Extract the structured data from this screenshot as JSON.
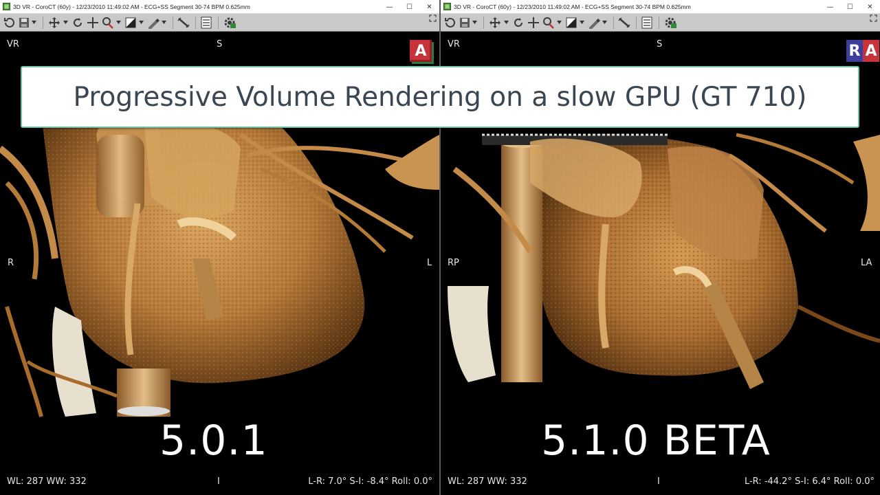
{
  "banner": {
    "text": "Progressive Volume Rendering on a slow GPU (GT 710)"
  },
  "viewers": [
    {
      "window_title": "3D VR - CoroCT (60y) - 12/23/2010 11:49:02 AM - ECG+SS Segment 30-74 BPM 0.625mm",
      "window_buttons": {
        "minimize": "—",
        "maximize": "☐",
        "close": "✕"
      },
      "labels": {
        "top_left": "VR",
        "top": "S",
        "left": "R",
        "right": "L"
      },
      "cube": [
        "A"
      ],
      "version": "5.0.1",
      "footer": {
        "window_level": "WL: 287 WW: 332",
        "center": "I",
        "rotation": "L-R: 7.0° S-I: -8.4° Roll: 0.0°"
      }
    },
    {
      "window_title": "3D VR - CoroCT (60y) - 12/23/2010 11:49:02 AM - ECG+SS Segment 30-74 BPM 0.625mm",
      "window_buttons": {
        "minimize": "—",
        "maximize": "☐",
        "close": "✕"
      },
      "labels": {
        "top_left": "VR",
        "top": "S",
        "left": "RP",
        "right": "LA"
      },
      "cube": [
        "R",
        "A"
      ],
      "version": "5.1.0 BETA",
      "footer": {
        "window_level": "WL: 287 WW: 332",
        "center": "I",
        "rotation": "L-R: -44.2° S-I: 6.4° Roll: 0.0°"
      }
    }
  ],
  "toolbar_icons": [
    "reset-icon",
    "save-icon",
    "pan-icon",
    "rotate-icon",
    "move-icon",
    "zoom-icon",
    "window-level-icon",
    "sculpt-icon",
    "measure-icon",
    "layout-icon",
    "gpu-settings-icon"
  ],
  "colors": {
    "banner_border": "#6fc2aa",
    "banner_text": "#3a4651",
    "toolbar_bg": "#c9c9c9",
    "cube_red": "#c8323a",
    "cube_blue": "#3b3f9e",
    "tissue": "#c8904a"
  }
}
